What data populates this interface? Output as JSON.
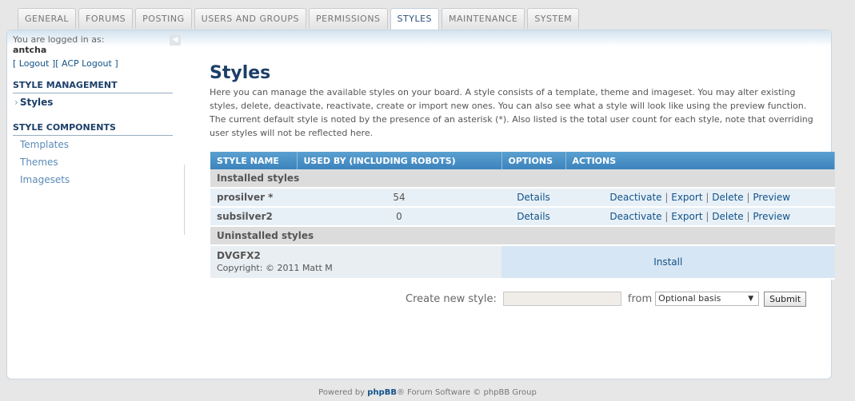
{
  "tabs": [
    "GENERAL",
    "FORUMS",
    "POSTING",
    "USERS AND GROUPS",
    "PERMISSIONS",
    "STYLES",
    "MAINTENANCE",
    "SYSTEM"
  ],
  "active_tab": "STYLES",
  "sidebar": {
    "logged_in_label": "You are logged in as:",
    "username": "antcha",
    "logout_label": "[ Logout ]",
    "acp_logout_label": "[ ACP Logout ]",
    "section1": "STYLE MANAGEMENT",
    "section1_items": [
      "Styles"
    ],
    "section2": "STYLE COMPONENTS",
    "section2_items": [
      "Templates",
      "Themes",
      "Imagesets"
    ]
  },
  "main": {
    "title": "Styles",
    "description": "Here you can manage the available styles on your board. A style consists of a template, theme and imageset. You may alter existing styles, delete, deactivate, reactivate, create or import new ones. You can also see what a style will look like using the preview function. The current default style is noted by the presence of an asterisk (*). Also listed is the total user count for each style, note that overriding user styles will not be reflected here."
  },
  "table": {
    "headers": [
      "STYLE NAME",
      "USED BY (INCLUDING ROBOTS)",
      "OPTIONS",
      "ACTIONS"
    ],
    "installed_label": "Installed styles",
    "installed": [
      {
        "name": "prosilver *",
        "count": "54",
        "option": "Details",
        "actions": [
          "Deactivate",
          "Export",
          "Delete",
          "Preview"
        ]
      },
      {
        "name": "subsilver2",
        "count": "0",
        "option": "Details",
        "actions": [
          "Deactivate",
          "Export",
          "Delete",
          "Preview"
        ]
      }
    ],
    "uninstalled_label": "Uninstalled styles",
    "uninstalled": {
      "name": "DVGFX2",
      "copyright": "Copyright: © 2011 Matt M",
      "action": "Install"
    }
  },
  "create": {
    "label": "Create new style:",
    "input_value": "",
    "from_label": "from",
    "select_value": "Optional basis",
    "submit_label": "Submit"
  },
  "footer": {
    "prefix": "Powered by ",
    "brand": "phpBB",
    "suffix": "® Forum Software © phpBB Group"
  }
}
